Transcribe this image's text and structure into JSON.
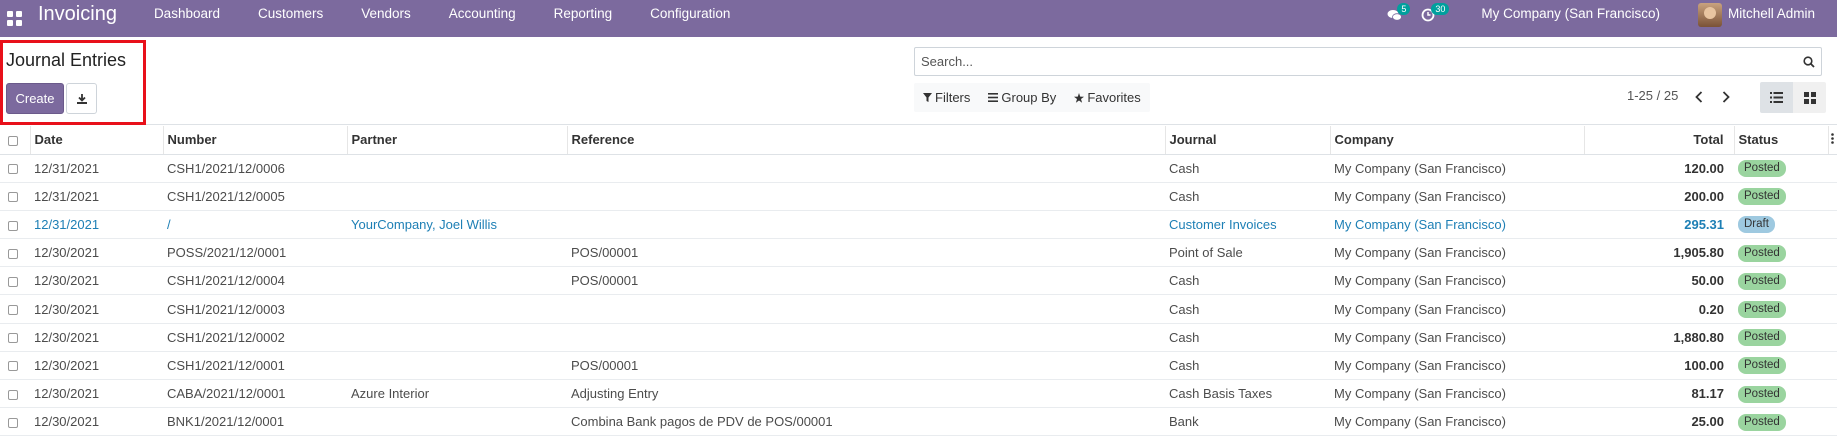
{
  "navbar": {
    "app_title": "Invoicing",
    "menu": [
      "Dashboard",
      "Customers",
      "Vendors",
      "Accounting",
      "Reporting",
      "Configuration"
    ],
    "messages_count": "5",
    "activities_count": "30",
    "company": "My Company (San Francisco)",
    "user": "Mitchell Admin",
    "color": "#7c6a9e"
  },
  "control": {
    "title": "Journal Entries",
    "create_label": "Create",
    "search_placeholder": "Search...",
    "filters_label": "Filters",
    "groupby_label": "Group By",
    "favorites_label": "Favorites",
    "pager": "1-25 / 25"
  },
  "table": {
    "headers": {
      "date": "Date",
      "number": "Number",
      "partner": "Partner",
      "reference": "Reference",
      "journal": "Journal",
      "company": "Company",
      "total": "Total",
      "status": "Status"
    },
    "rows": [
      {
        "date": "12/31/2021",
        "number": "CSH1/2021/12/0006",
        "partner": "",
        "reference": "",
        "journal": "Cash",
        "company": "My Company (San Francisco)",
        "total": "120.00",
        "status": "Posted"
      },
      {
        "date": "12/31/2021",
        "number": "CSH1/2021/12/0005",
        "partner": "",
        "reference": "",
        "journal": "Cash",
        "company": "My Company (San Francisco)",
        "total": "200.00",
        "status": "Posted"
      },
      {
        "date": "12/31/2021",
        "number": "/",
        "partner": "YourCompany, Joel Willis",
        "reference": "",
        "journal": "Customer Invoices",
        "company": "My Company (San Francisco)",
        "total": "295.31",
        "status": "Draft"
      },
      {
        "date": "12/30/2021",
        "number": "POSS/2021/12/0001",
        "partner": "",
        "reference": "POS/00001",
        "journal": "Point of Sale",
        "company": "My Company (San Francisco)",
        "total": "1,905.80",
        "status": "Posted"
      },
      {
        "date": "12/30/2021",
        "number": "CSH1/2021/12/0004",
        "partner": "",
        "reference": "POS/00001",
        "journal": "Cash",
        "company": "My Company (San Francisco)",
        "total": "50.00",
        "status": "Posted"
      },
      {
        "date": "12/30/2021",
        "number": "CSH1/2021/12/0003",
        "partner": "",
        "reference": "",
        "journal": "Cash",
        "company": "My Company (San Francisco)",
        "total": "0.20",
        "status": "Posted"
      },
      {
        "date": "12/30/2021",
        "number": "CSH1/2021/12/0002",
        "partner": "",
        "reference": "",
        "journal": "Cash",
        "company": "My Company (San Francisco)",
        "total": "1,880.80",
        "status": "Posted"
      },
      {
        "date": "12/30/2021",
        "number": "CSH1/2021/12/0001",
        "partner": "",
        "reference": "POS/00001",
        "journal": "Cash",
        "company": "My Company (San Francisco)",
        "total": "100.00",
        "status": "Posted"
      },
      {
        "date": "12/30/2021",
        "number": "CABA/2021/12/0001",
        "partner": "Azure Interior",
        "reference": "Adjusting Entry",
        "journal": "Cash Basis Taxes",
        "company": "My Company (San Francisco)",
        "total": "81.17",
        "status": "Posted"
      },
      {
        "date": "12/30/2021",
        "number": "BNK1/2021/12/0001",
        "partner": "",
        "reference": "Combina Bank pagos de PDV de POS/00001",
        "journal": "Bank",
        "company": "My Company (San Francisco)",
        "total": "25.00",
        "status": "Posted"
      }
    ]
  },
  "colors": {
    "posted": "#9ad49f",
    "draft": "#9ec9e0",
    "highlight": "#e8101a"
  }
}
